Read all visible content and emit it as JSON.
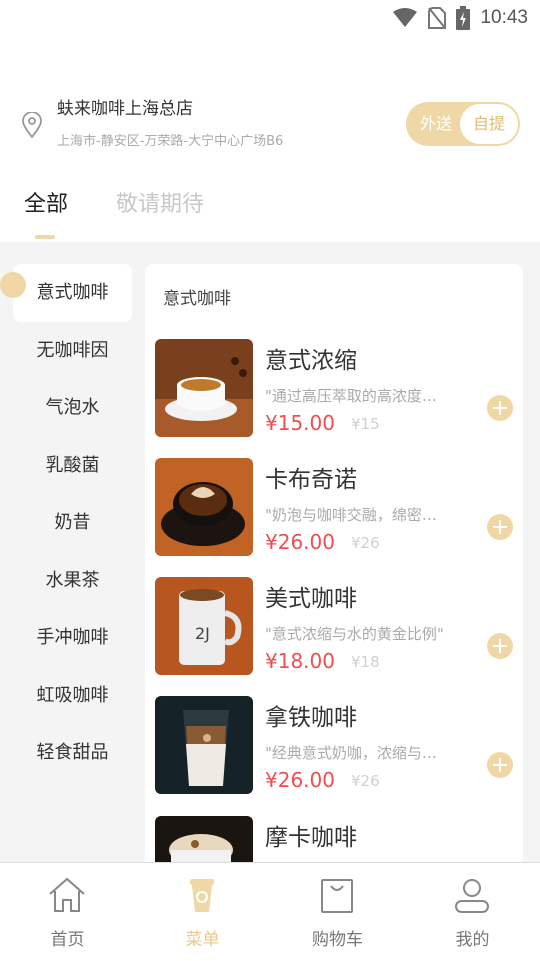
{
  "status_bar": {
    "time": "10:43",
    "icons": [
      "wifi-icon",
      "no-sim-icon",
      "battery-charging-icon"
    ]
  },
  "store": {
    "name": "蚨来咖啡上海总店",
    "address": "上海市-静安区-万荣路-大宁中心广场B6",
    "icon": "location-pin-icon",
    "modes": {
      "delivery": "外送",
      "pickup": "自提"
    }
  },
  "tabs": [
    {
      "label": "全部"
    },
    {
      "label": "敬请期待"
    }
  ],
  "categories": [
    {
      "label": "意式咖啡"
    },
    {
      "label": "无咖啡因"
    },
    {
      "label": "气泡水"
    },
    {
      "label": "乳酸菌"
    },
    {
      "label": "奶昔"
    },
    {
      "label": "水果茶"
    },
    {
      "label": "手冲咖啡"
    },
    {
      "label": "虹吸咖啡"
    },
    {
      "label": "轻食甜品"
    }
  ],
  "current_category": {
    "title": "意式咖啡"
  },
  "products": [
    {
      "name": "意式浓缩",
      "desc": "\"通过高压萃取的高浓度咖啡\"",
      "price": "¥15.00",
      "old_price": "¥15"
    },
    {
      "name": "卡布奇诺",
      "desc": "\"奶泡与咖啡交融，绵密顺滑\"",
      "price": "¥26.00",
      "old_price": "¥26"
    },
    {
      "name": "美式咖啡",
      "desc": "\"意式浓缩与水的黄金比例\"",
      "price": "¥18.00",
      "old_price": "¥18"
    },
    {
      "name": "拿铁咖啡",
      "desc": "\"经典意式奶咖，浓缩与牛奶\"",
      "price": "¥26.00",
      "old_price": "¥26"
    },
    {
      "name": "摩卡咖啡"
    }
  ],
  "bottom_nav": [
    {
      "label": "首页",
      "icon": "home-icon"
    },
    {
      "label": "菜单",
      "icon": "coffee-cup-icon"
    },
    {
      "label": "购物车",
      "icon": "shopping-bag-icon"
    },
    {
      "label": "我的",
      "icon": "user-icon"
    }
  ],
  "colors": {
    "accent": "#f0d8a6",
    "accent_text": "#e3bb72",
    "price": "#ef4e4e",
    "panel_bg": "#f4f4f4"
  }
}
